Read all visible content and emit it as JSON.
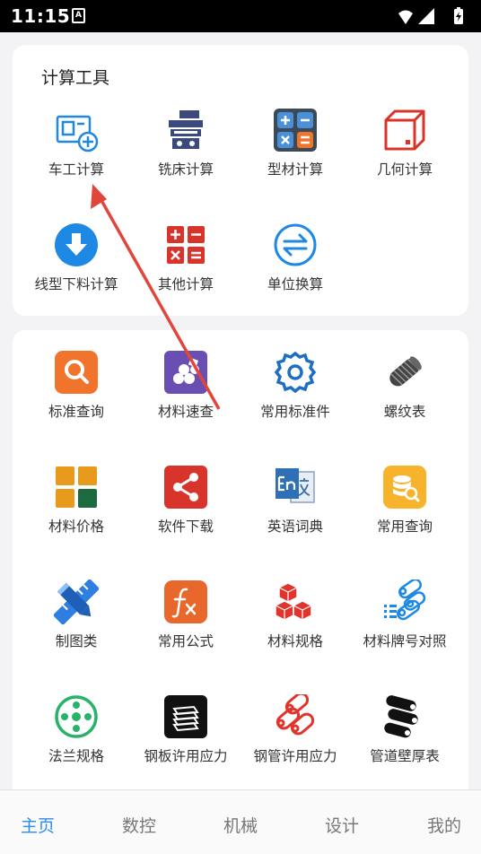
{
  "status": {
    "time": "11:15",
    "notif_glyph": "A"
  },
  "calc": {
    "title": "计算工具",
    "items": [
      {
        "label": "车工计算",
        "icon": "lathe-icon"
      },
      {
        "label": "铣床计算",
        "icon": "milling-icon"
      },
      {
        "label": "型材计算",
        "icon": "calculator-icon"
      },
      {
        "label": "几何计算",
        "icon": "cube-icon"
      },
      {
        "label": "线型下料计算",
        "icon": "download-icon"
      },
      {
        "label": "其他计算",
        "icon": "math-ops-icon"
      },
      {
        "label": "单位换算",
        "icon": "convert-icon"
      }
    ]
  },
  "ref": {
    "items": [
      {
        "label": "标准查询",
        "icon": "search-icon"
      },
      {
        "label": "材料速查",
        "icon": "materials-icon"
      },
      {
        "label": "常用标准件",
        "icon": "gear-icon"
      },
      {
        "label": "螺纹表",
        "icon": "thread-icon"
      },
      {
        "label": "材料价格",
        "icon": "grid-icon"
      },
      {
        "label": "软件下载",
        "icon": "share-icon"
      },
      {
        "label": "英语词典",
        "icon": "dictionary-icon"
      },
      {
        "label": "常用查询",
        "icon": "database-search-icon"
      },
      {
        "label": "制图类",
        "icon": "pencil-ruler-icon"
      },
      {
        "label": "常用公式",
        "icon": "formula-icon"
      },
      {
        "label": "材料规格",
        "icon": "boxes-icon"
      },
      {
        "label": "材料牌号对照",
        "icon": "pipes-list-icon"
      },
      {
        "label": "法兰规格",
        "icon": "flange-icon"
      },
      {
        "label": "钢板许用应力",
        "icon": "steel-plate-icon"
      },
      {
        "label": "钢管许用应力",
        "icon": "steel-pipe-icon"
      },
      {
        "label": "管道壁厚表",
        "icon": "pipe-wall-icon"
      }
    ]
  },
  "tabs": [
    {
      "label": "主页",
      "active": true
    },
    {
      "label": "数控",
      "active": false
    },
    {
      "label": "机械",
      "active": false
    },
    {
      "label": "设计",
      "active": false
    },
    {
      "label": "我的",
      "active": false
    }
  ],
  "colors": {
    "accent": "#2d8cf0",
    "blue_icon": "#1e88e5",
    "navy_icon": "#3b4a7a",
    "red_icon": "#d9342b",
    "orange_icon": "#f0742c",
    "purple_icon": "#6a4fb3",
    "annotation_arrow": "#e0463a"
  }
}
